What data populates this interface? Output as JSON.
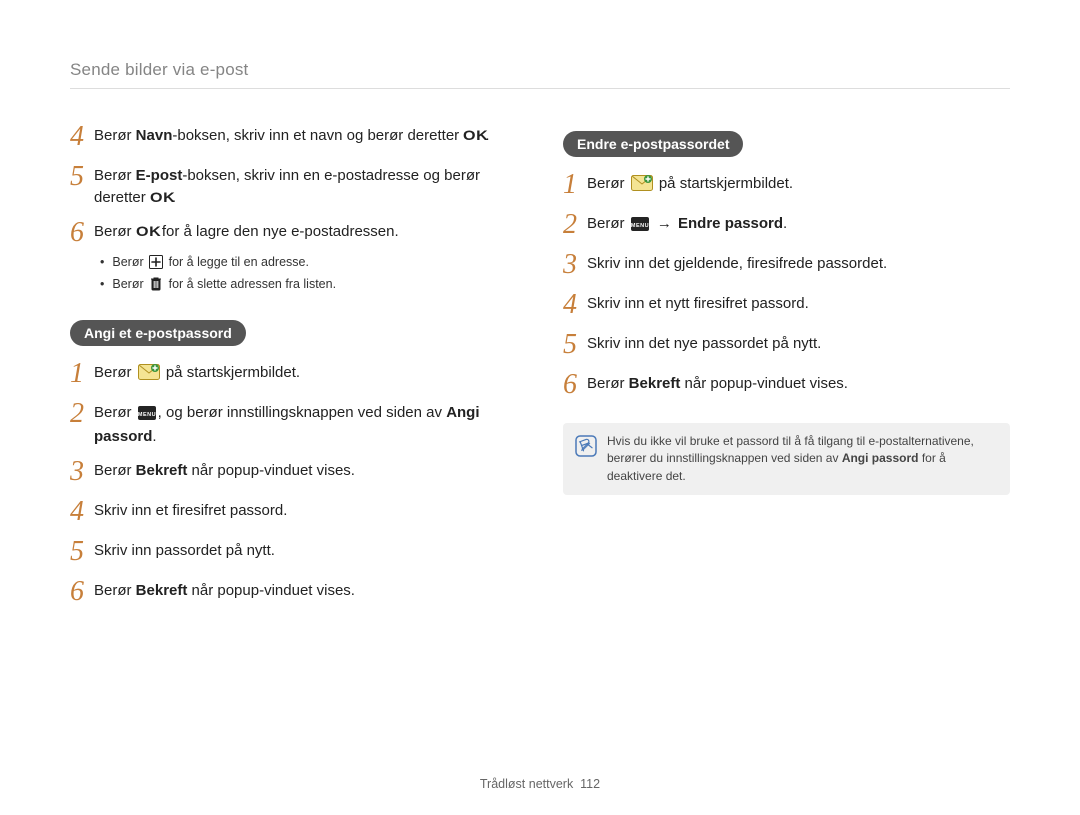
{
  "page_title": "Sende bilder via e-post",
  "footer": {
    "section": "Trådløst nettverk",
    "page": "112"
  },
  "left": {
    "steps_a": [
      {
        "num": "4",
        "parts": [
          "Berør ",
          {
            "b": "Navn"
          },
          "-boksen, skriv inn et navn og berør deretter ",
          {
            "ok": true
          },
          "."
        ]
      },
      {
        "num": "5",
        "parts": [
          "Berør ",
          {
            "b": "E-post"
          },
          "-boksen, skriv inn en e-postadresse og berør deretter ",
          {
            "ok": true
          },
          "."
        ]
      },
      {
        "num": "6",
        "parts": [
          "Berør ",
          {
            "ok": true
          },
          " for å lagre den nye e-postadressen."
        ]
      }
    ],
    "sub_a": [
      {
        "pre": "Berør ",
        "icon": "plus",
        "post": " for å legge til en adresse."
      },
      {
        "pre": "Berør ",
        "icon": "trash",
        "post": " for å slette adressen fra listen."
      }
    ],
    "heading_b": "Angi et e-postpassord",
    "steps_b": [
      {
        "num": "1",
        "parts": [
          "Berør ",
          {
            "icon": "email"
          },
          " på startskjermbildet."
        ]
      },
      {
        "num": "2",
        "parts": [
          "Berør ",
          {
            "icon": "menu"
          },
          ", og berør innstillingsknappen ved siden av ",
          {
            "b": "Angi passord"
          },
          "."
        ]
      },
      {
        "num": "3",
        "parts": [
          "Berør ",
          {
            "b": "Bekreft"
          },
          " når popup-vinduet vises."
        ]
      },
      {
        "num": "4",
        "parts": [
          "Skriv inn et firesifret passord."
        ]
      },
      {
        "num": "5",
        "parts": [
          "Skriv inn passordet på nytt."
        ]
      },
      {
        "num": "6",
        "parts": [
          "Berør ",
          {
            "b": "Bekreft"
          },
          " når popup-vinduet vises."
        ]
      }
    ]
  },
  "right": {
    "heading": "Endre e-postpassordet",
    "steps": [
      {
        "num": "1",
        "parts": [
          "Berør ",
          {
            "icon": "email"
          },
          " på startskjermbildet."
        ]
      },
      {
        "num": "2",
        "parts": [
          "Berør ",
          {
            "icon": "menu"
          },
          " ",
          {
            "arrow": true
          },
          " ",
          {
            "b": "Endre passord"
          },
          "."
        ]
      },
      {
        "num": "3",
        "parts": [
          "Skriv inn det gjeldende, firesifrede passordet."
        ]
      },
      {
        "num": "4",
        "parts": [
          "Skriv inn et nytt firesifret passord."
        ]
      },
      {
        "num": "5",
        "parts": [
          "Skriv inn det nye passordet på nytt."
        ]
      },
      {
        "num": "6",
        "parts": [
          "Berør ",
          {
            "b": "Bekreft"
          },
          " når popup-vinduet vises."
        ]
      }
    ],
    "note": {
      "parts": [
        "Hvis du ikke vil bruke et passord til å få tilgang til e-postalternativene, berører du innstillingsknappen ved siden av ",
        {
          "b": "Angi passord"
        },
        " for å deaktivere det."
      ]
    }
  }
}
